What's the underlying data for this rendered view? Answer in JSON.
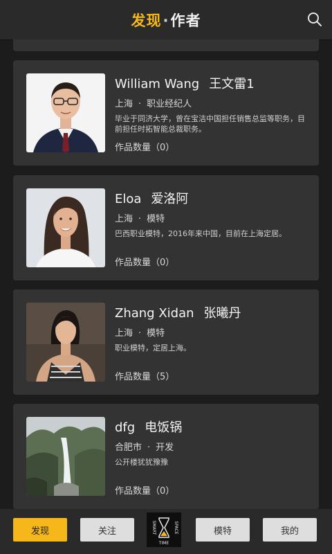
{
  "header": {
    "title_accent": "发现",
    "title_dot": "·",
    "title_rest": "作者"
  },
  "authors": [
    {
      "name_en": "William Wang",
      "name_cn": "王文雷1",
      "city": "上海",
      "sep": "·",
      "role": "职业经纪人",
      "desc": "毕业于同济大学，曾在宝洁中国担任销售总监等职务，目前担任时拓智能总裁职务。",
      "works": "作品数量（0）"
    },
    {
      "name_en": "Eloa",
      "name_cn": "爱洛阿",
      "city": "上海",
      "sep": "·",
      "role": "模特",
      "desc": "巴西职业模特，2016年来中国，目前在上海定居。",
      "works": "作品数量（0）"
    },
    {
      "name_en": "Zhang Xidan",
      "name_cn": "张曦丹",
      "city": "上海",
      "sep": "·",
      "role": "模特",
      "desc": "职业模特，定居上海。",
      "works": "作品数量（5）"
    },
    {
      "name_en": "dfg",
      "name_cn": "电饭锅",
      "city": "合肥市",
      "sep": "·",
      "role": "开发",
      "desc": "公开楼犹犹豫豫",
      "works": "作品数量（0）"
    }
  ],
  "bottom_nav": {
    "discover": "发现",
    "follow": "关注",
    "logo_left": "SMART",
    "logo_right": "SPACE",
    "logo_bottom": "TIME",
    "model": "模特",
    "mine": "我的"
  },
  "colors": {
    "accent": "#f5b71a",
    "card": "#333333",
    "background": "#1c1c1c"
  },
  "icons": {
    "search": "search-icon",
    "logo": "smart-space-time-logo"
  }
}
